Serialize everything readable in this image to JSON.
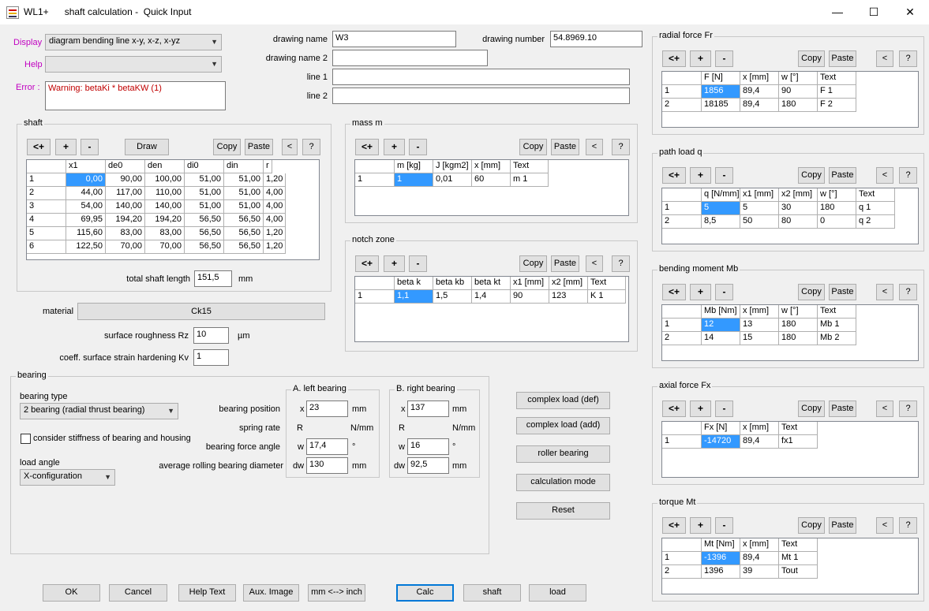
{
  "window": {
    "app": "WL1+",
    "title": "shaft calculation -  Quick Input",
    "minimize": "—",
    "maximize": "☐",
    "close": "✕"
  },
  "top": {
    "display_label": "Display",
    "display_value": "diagram bending line x-y, x-z, x-yz",
    "help_label": "Help",
    "help_value": "",
    "error_label": "Error :",
    "error_text": "Warning: betaKi * betaKW (1)",
    "drawing_name_label": "drawing name",
    "drawing_name": "W3",
    "drawing_number_label": "drawing number",
    "drawing_number": "54.8969.10",
    "drawing_name2_label": "drawing name 2",
    "drawing_name2": "",
    "line1_label": "line 1",
    "line1": "",
    "line2_label": "line 2",
    "line2": ""
  },
  "table_buttons": {
    "insert": "<+",
    "add": "+",
    "remove": "-",
    "copy": "Copy",
    "paste": "Paste",
    "prev": "<",
    "help": "?"
  },
  "shaft": {
    "title": "shaft",
    "draw": "Draw",
    "columns": [
      "",
      "x1",
      "de0",
      "den",
      "di0",
      "din",
      "r"
    ],
    "rows": [
      [
        "1",
        "0,00",
        "90,00",
        "100,00",
        "51,00",
        "51,00",
        "1,20"
      ],
      [
        "2",
        "44,00",
        "117,00",
        "110,00",
        "51,00",
        "51,00",
        "4,00"
      ],
      [
        "3",
        "54,00",
        "140,00",
        "140,00",
        "51,00",
        "51,00",
        "4,00"
      ],
      [
        "4",
        "69,95",
        "194,20",
        "194,20",
        "56,50",
        "56,50",
        "4,00"
      ],
      [
        "5",
        "115,60",
        "83,00",
        "83,00",
        "56,50",
        "56,50",
        "1,20"
      ],
      [
        "6",
        "122,50",
        "70,00",
        "70,00",
        "56,50",
        "56,50",
        "1,20"
      ]
    ],
    "total_length_label": "total shaft length",
    "total_length": "151,5",
    "total_length_unit": "mm"
  },
  "material": {
    "label": "material",
    "value": "Ck15",
    "roughness_label": "surface roughness Rz",
    "roughness": "10",
    "roughness_unit": "µm",
    "kv_label": "coeff. surface strain hardening Kv",
    "kv": "1"
  },
  "mass": {
    "title": "mass m",
    "columns": [
      "",
      "m [kg]",
      "J [kgm2]",
      "x [mm]",
      "Text"
    ],
    "rows": [
      [
        "1",
        "1",
        "0,01",
        "60",
        "m 1"
      ]
    ]
  },
  "notch": {
    "title": "notch zone",
    "columns": [
      "",
      "beta k",
      "beta kb",
      "beta kt",
      "x1 [mm]",
      "x2 [mm]",
      "Text"
    ],
    "rows": [
      [
        "1",
        "1,1",
        "1,5",
        "1,4",
        "90",
        "123",
        "K 1"
      ]
    ]
  },
  "bearing": {
    "title": "bearing",
    "type_label": "bearing type",
    "type_value": "2 bearing (radial thrust bearing)",
    "stiffness_label": "consider stiffness of bearing and housing",
    "load_angle_label": "load angle",
    "load_angle_value": "X-configuration",
    "position_label": "bearing position",
    "spring_label": "spring rate",
    "force_angle_label": "bearing force angle",
    "diameter_label": "average rolling bearing diameter",
    "left": {
      "title": "A. left bearing",
      "x_prefix": "x",
      "x": "23",
      "x_unit": "mm",
      "r_prefix": "R",
      "r_unit": "N/mm",
      "w_prefix": "w",
      "w": "17,4",
      "w_unit": "°",
      "dw_prefix": "dw",
      "dw": "130",
      "dw_unit": "mm"
    },
    "right": {
      "title": "B. right bearing",
      "x_prefix": "x",
      "x": "137",
      "x_unit": "mm",
      "r_prefix": "R",
      "r_unit": "N/mm",
      "w_prefix": "w",
      "w": "16",
      "w_unit": "°",
      "dw_prefix": "dw",
      "dw": "92,5",
      "dw_unit": "mm"
    }
  },
  "actions": {
    "complex_def": "complex load (def)",
    "complex_add": "complex load (add)",
    "roller": "roller bearing",
    "calc_mode": "calculation mode",
    "reset": "Reset"
  },
  "bottom": {
    "ok": "OK",
    "cancel": "Cancel",
    "help_text": "Help Text",
    "aux_image": "Aux. Image",
    "units": "mm <--> inch",
    "calc": "Calc",
    "shaft": "shaft",
    "load": "load"
  },
  "radial": {
    "title": "radial force Fr",
    "columns": [
      "",
      "F [N]",
      "x [mm]",
      "w [°]",
      "Text"
    ],
    "rows": [
      [
        "1",
        "1856",
        "89,4",
        "90",
        "F 1"
      ],
      [
        "2",
        "18185",
        "89,4",
        "180",
        "F 2"
      ]
    ]
  },
  "path": {
    "title": "path load q",
    "columns": [
      "",
      "q [N/mm]",
      "x1 [mm]",
      "x2 [mm]",
      "w [°]",
      "Text"
    ],
    "rows": [
      [
        "1",
        "5",
        "5",
        "30",
        "180",
        "q 1"
      ],
      [
        "2",
        "8,5",
        "50",
        "80",
        "0",
        "q 2"
      ]
    ]
  },
  "bending": {
    "title": "bending moment Mb",
    "columns": [
      "",
      "Mb [Nm]",
      "x [mm]",
      "w [°]",
      "Text"
    ],
    "rows": [
      [
        "1",
        "12",
        "13",
        "180",
        "Mb 1"
      ],
      [
        "2",
        "14",
        "15",
        "180",
        "Mb 2"
      ]
    ]
  },
  "axial": {
    "title": "axial force Fx",
    "columns": [
      "",
      "Fx [N]",
      "x [mm]",
      "Text"
    ],
    "rows": [
      [
        "1",
        "-14720",
        "89,4",
        "fx1"
      ]
    ]
  },
  "torque": {
    "title": "torque Mt",
    "columns": [
      "",
      "Mt [Nm]",
      "x [mm]",
      "Text"
    ],
    "rows": [
      [
        "1",
        "-1396",
        "89,4",
        "Mt 1"
      ],
      [
        "2",
        "1396",
        "39",
        "Tout"
      ]
    ]
  }
}
